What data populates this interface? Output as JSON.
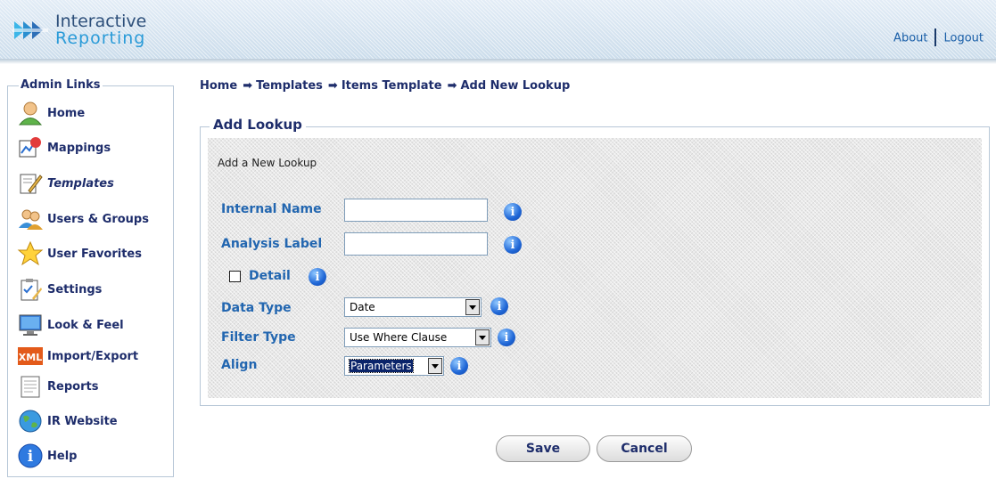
{
  "app": {
    "title_line1": "Interactive",
    "title_line2": "Reporting"
  },
  "top_links": {
    "about": "About",
    "logout": "Logout"
  },
  "sidebar": {
    "legend": "Admin Links",
    "items": [
      {
        "label": "Home",
        "icon": "user-icon"
      },
      {
        "label": "Mappings",
        "icon": "mappings-icon"
      },
      {
        "label": "Templates",
        "icon": "pencil-icon",
        "active": true
      },
      {
        "label": "Users & Groups",
        "icon": "users-icon"
      },
      {
        "label": "User Favorites",
        "icon": "star-icon"
      },
      {
        "label": "Settings",
        "icon": "clipboard-icon"
      },
      {
        "label": "Look & Feel",
        "icon": "monitor-icon"
      },
      {
        "label": "Import/Export",
        "icon": "xml-icon"
      },
      {
        "label": "Reports",
        "icon": "report-icon"
      },
      {
        "label": "IR Website",
        "icon": "globe-icon"
      },
      {
        "label": "Help",
        "icon": "info-icon"
      }
    ]
  },
  "breadcrumb": {
    "items": [
      "Home",
      "Templates",
      "Items Template",
      "Add New Lookup"
    ],
    "separator": "➡"
  },
  "form": {
    "legend": "Add Lookup",
    "subtitle": "Add a New Lookup",
    "internal_name": {
      "label": "Internal Name",
      "value": ""
    },
    "analysis_label": {
      "label": "Analysis Label",
      "value": ""
    },
    "detail": {
      "label": "Detail",
      "checked": false
    },
    "data_type": {
      "label": "Data Type",
      "value": "Date"
    },
    "filter_type": {
      "label": "Filter Type",
      "value": "Use Where Clause"
    },
    "align": {
      "label": "Align",
      "value": "Parameters"
    },
    "info_glyph": "i"
  },
  "buttons": {
    "save": "Save",
    "cancel": "Cancel"
  },
  "colors": {
    "nav_text": "#1e2d6b",
    "field_label": "#2266b0",
    "link": "#1a5fa8"
  }
}
